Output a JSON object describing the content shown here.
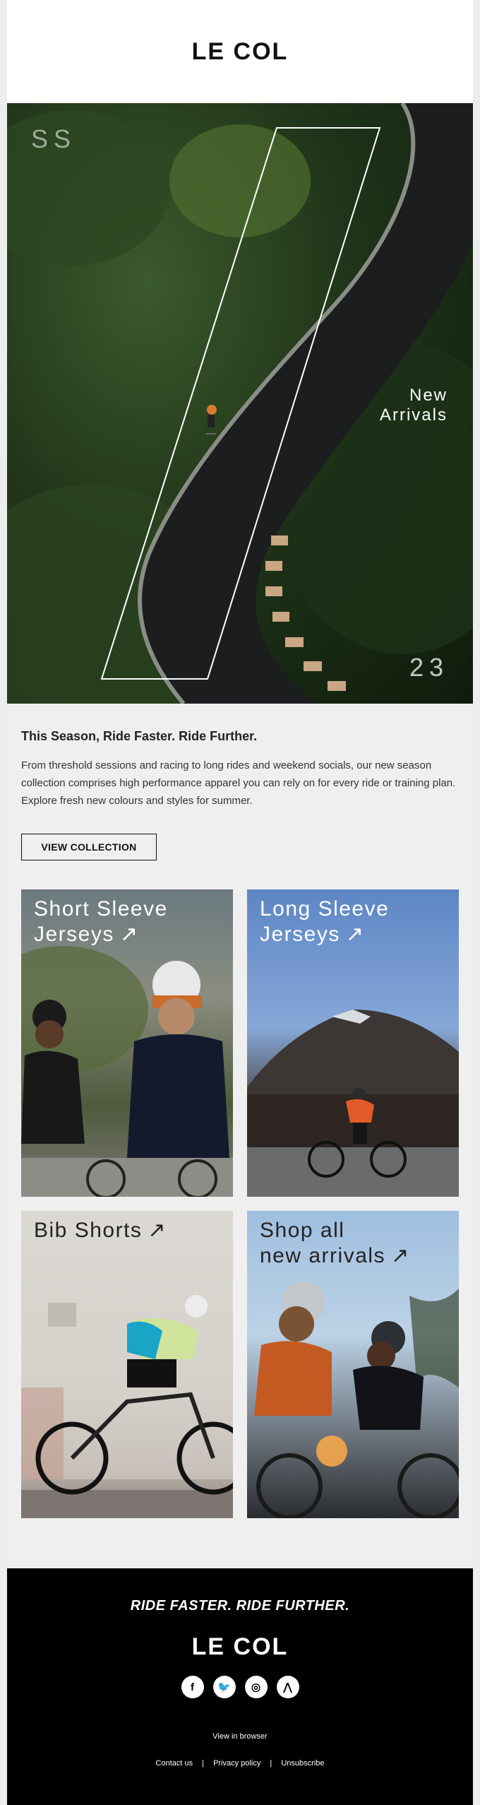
{
  "brand": {
    "logo": "LE COL"
  },
  "hero": {
    "season": "SS",
    "year": "23",
    "callout_line1": "New",
    "callout_line2": "Arrivals"
  },
  "intro": {
    "heading": "This Season, Ride Faster. Ride Further.",
    "body": "From threshold sessions and racing to long rides and weekend socials, our new season collection comprises high performance apparel you can rely on for every ride or training plan. Explore fresh new colours and styles for summer.",
    "cta": "VIEW COLLECTION"
  },
  "tiles": [
    {
      "line1": "Short Sleeve",
      "line2": "Jerseys",
      "arrow": "↗"
    },
    {
      "line1": "Long Sleeve",
      "line2": "Jerseys",
      "arrow": "↗"
    },
    {
      "line1": "Bib Shorts",
      "line2": "",
      "arrow": "↗"
    },
    {
      "line1": "Shop all",
      "line2": "new arrivals",
      "arrow": "↗"
    }
  ],
  "footer": {
    "tagline": "RIDE FASTER. RIDE FURTHER.",
    "logo": "LE COL",
    "socials": [
      {
        "icon": "facebook-icon",
        "glyph": "f"
      },
      {
        "icon": "twitter-icon",
        "glyph": "🐦"
      },
      {
        "icon": "instagram-icon",
        "glyph": "◎"
      },
      {
        "icon": "strava-icon",
        "glyph": "⋀"
      }
    ],
    "view_in_browser": "View in browser",
    "links": [
      "Contact us",
      "Privacy policy",
      "Unsubscribe"
    ],
    "separator": "|"
  },
  "colors": {
    "header_bg": "#ffffff",
    "body_bg": "#efefef",
    "footer_bg": "#000000",
    "text": "#222222"
  }
}
